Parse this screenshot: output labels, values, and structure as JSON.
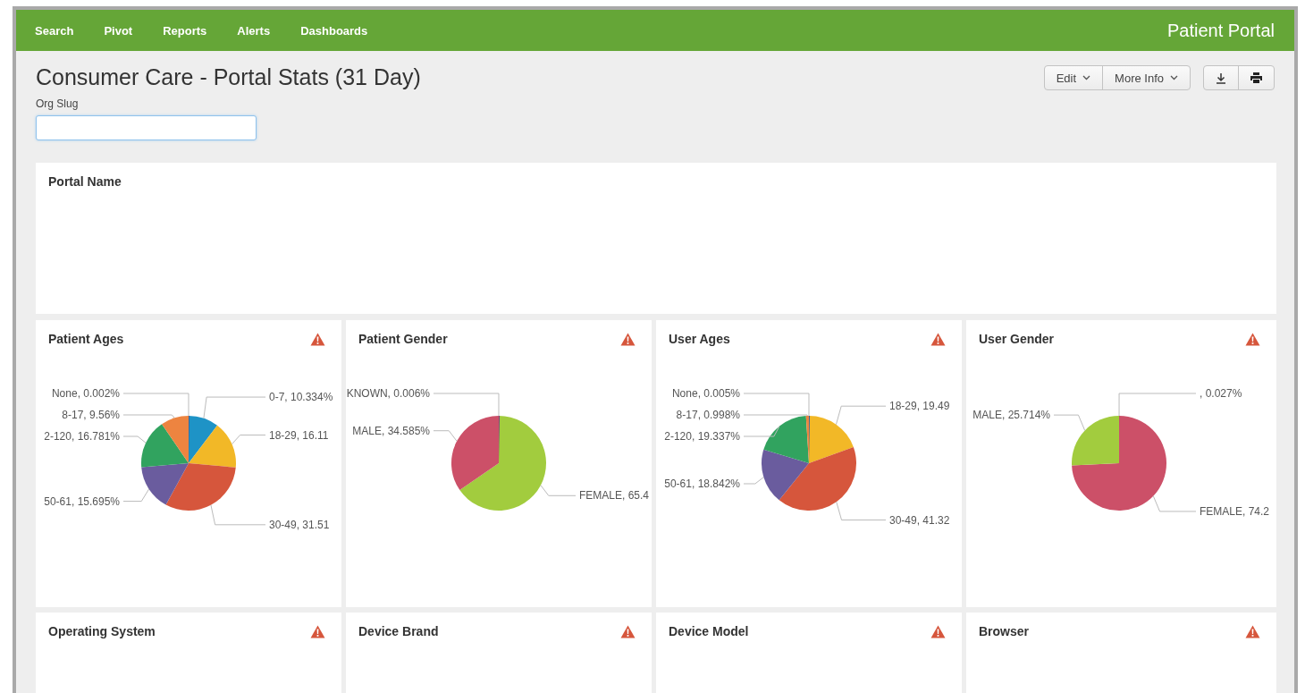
{
  "nav": {
    "items": [
      "Search",
      "Pivot",
      "Reports",
      "Alerts",
      "Dashboards"
    ],
    "app_title": "Patient Portal"
  },
  "dashboard": {
    "title": "Consumer Care - Portal Stats (31 Day)",
    "buttons": [
      "Edit",
      "More Info"
    ]
  },
  "filter": {
    "label": "Org Slug"
  },
  "portal_panel": {
    "title": "Portal Name",
    "warning": false
  },
  "rows": [
    [
      {
        "title": "Patient Ages",
        "warning": true,
        "chart_data": {
          "type": "pie",
          "categories": [
            "0-7",
            "18-29",
            "30-49",
            "50-61",
            "2-120",
            "8-17",
            "None"
          ],
          "values": [
            10.334,
            16.11,
            31.51,
            15.695,
            16.781,
            9.56,
            0.002
          ],
          "colors": [
            "#1e93c6",
            "#f2b827",
            "#d6563c",
            "#6a5c9e",
            "#31a35f",
            "#ed8440",
            "#3863a0"
          ],
          "value_labels": [
            ", 10.334%",
            ", 16.11",
            ", 31.51",
            ", 15.695%",
            ", 16.781%",
            ", 9.56%",
            ", 0.002%"
          ]
        }
      },
      {
        "title": "Patient Gender",
        "warning": true,
        "chart_data": {
          "type": "pie",
          "categories": [
            "FEMALE",
            "MALE",
            "KNOWN"
          ],
          "values": [
            65.4,
            34.585,
            0.006
          ],
          "colors": [
            "#a2cc3e",
            "#cc5068",
            "#73427f"
          ],
          "value_labels": [
            ", 65.4",
            ", 34.585%",
            ", 0.006%"
          ]
        }
      },
      {
        "title": "User Ages",
        "warning": true,
        "chart_data": {
          "type": "pie",
          "categories": [
            "18-29",
            "30-49",
            "50-61",
            "2-120",
            "8-17",
            "None"
          ],
          "values": [
            19.49,
            41.32,
            18.842,
            19.337,
            0.998,
            0.005
          ],
          "colors": [
            "#f2b827",
            "#d6563c",
            "#6a5c9e",
            "#31a35f",
            "#ed8440",
            "#3863a0"
          ],
          "value_labels": [
            ", 19.49",
            ", 41.32",
            ", 18.842%",
            ", 19.337%",
            ", 0.998%",
            ", 0.005%"
          ]
        }
      },
      {
        "title": "User Gender",
        "warning": true,
        "chart_data": {
          "type": "pie",
          "categories": [
            null,
            "FEMALE",
            "MALE"
          ],
          "values": [
            0.027,
            74.2,
            25.714
          ],
          "colors": [
            "#73427f",
            "#cc5068",
            "#a2cc3e"
          ],
          "value_labels": [
            ", 0.027%",
            ", 74.2",
            ", 25.714%"
          ]
        }
      }
    ],
    [
      {
        "title": "Operating System",
        "warning": true
      },
      {
        "title": "Device Brand",
        "warning": true
      },
      {
        "title": "Device Model",
        "warning": true
      },
      {
        "title": "Browser",
        "warning": true
      }
    ]
  ]
}
